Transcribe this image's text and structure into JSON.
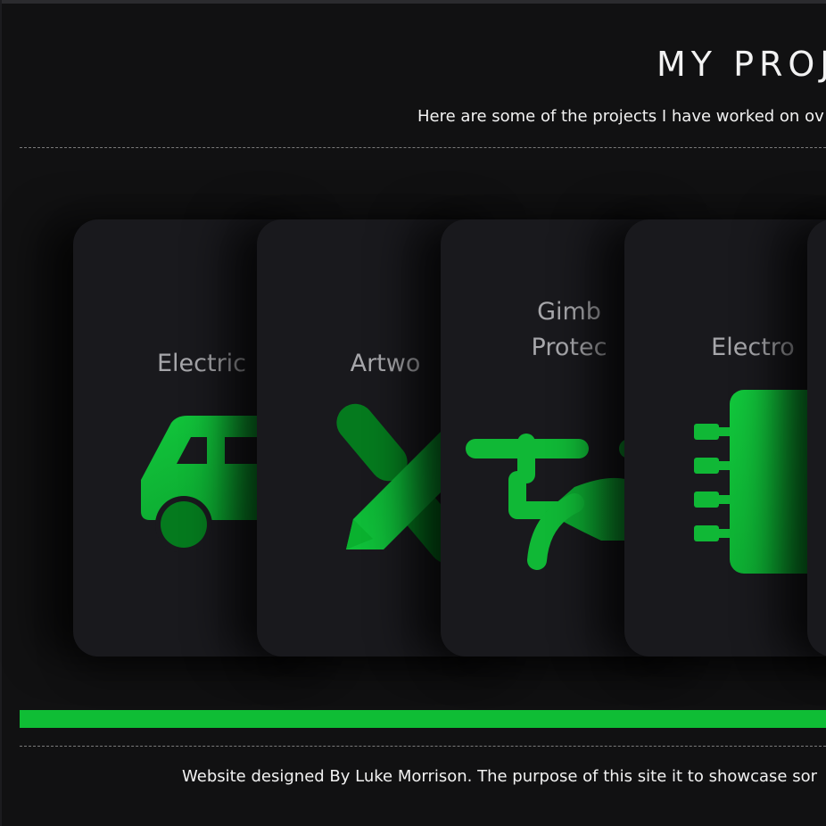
{
  "header": {
    "title": "MY PROJ",
    "subtitle": "Here are some of the projects I have worked on ov"
  },
  "cards": [
    {
      "title": "Electric",
      "icon": "car-icon"
    },
    {
      "title": "Artwo",
      "icon": "pencil-ruler-icon"
    },
    {
      "title": "Gimb\nProtec",
      "icon": "gimbal-icon"
    },
    {
      "title": "Electro",
      "icon": "chip-icon"
    },
    {
      "title": "",
      "icon": ""
    }
  ],
  "progress": {
    "value": 1.0,
    "color": "#0fbd35"
  },
  "footer": {
    "text": "Website designed By Luke Morrison. The purpose of this site it to showcase sor"
  },
  "colors": {
    "accent": "#10c13a",
    "accent_dark": "#057a1e",
    "background": "#111112",
    "card": "#19191d"
  }
}
